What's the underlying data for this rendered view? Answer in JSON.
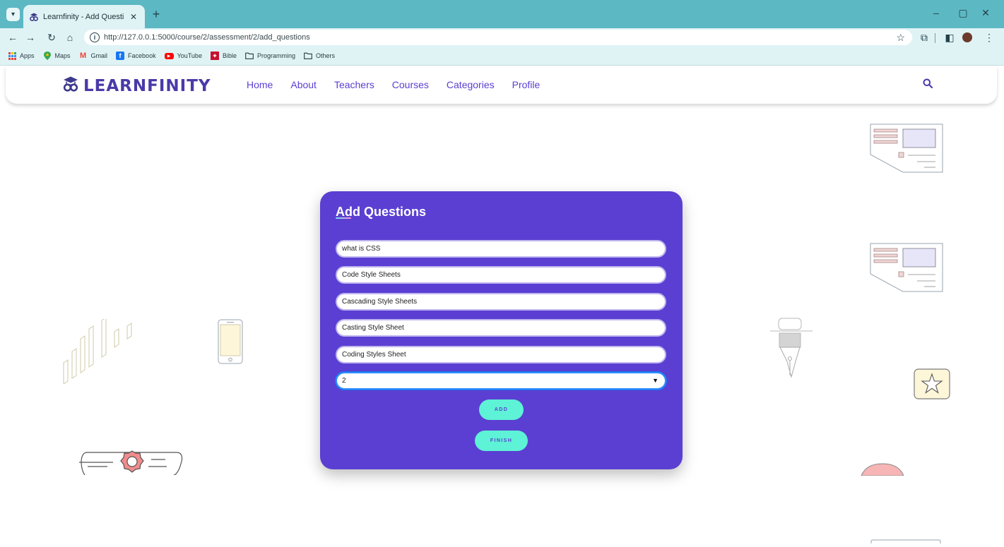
{
  "browser": {
    "tab_title": "Learnfinity - Add Questions",
    "url": "http://127.0.0.1:5000/course/2/assessment/2/add_questions",
    "bookmarks": [
      {
        "label": "Apps",
        "icon": "apps-grid-icon"
      },
      {
        "label": "Maps",
        "icon": "maps-pin-icon"
      },
      {
        "label": "Gmail",
        "icon": "gmail-icon"
      },
      {
        "label": "Facebook",
        "icon": "facebook-icon"
      },
      {
        "label": "YouTube",
        "icon": "youtube-icon"
      },
      {
        "label": "Bible",
        "icon": "bible-icon"
      },
      {
        "label": "Programming",
        "icon": "folder-icon"
      },
      {
        "label": "Others",
        "icon": "folder-icon"
      }
    ]
  },
  "site": {
    "logo_text": "LEARNFINITY",
    "nav": [
      "Home",
      "About",
      "Teachers",
      "Courses",
      "Categories",
      "Profile"
    ]
  },
  "form": {
    "title": "Add Questions",
    "question": "what is CSS",
    "options": [
      "Code Style Sheets",
      "Cascading Style Sheets",
      "Casting Style Sheet",
      "Coding Styles Sheet"
    ],
    "answer_select": "2",
    "add_label": "ADD",
    "finish_label": "FINISH"
  },
  "colors": {
    "tabstrip": "#5cb8c3",
    "toolbar": "#dff3f5",
    "brand_purple": "#5b3fd2",
    "button_mint": "#5ef2d6"
  }
}
